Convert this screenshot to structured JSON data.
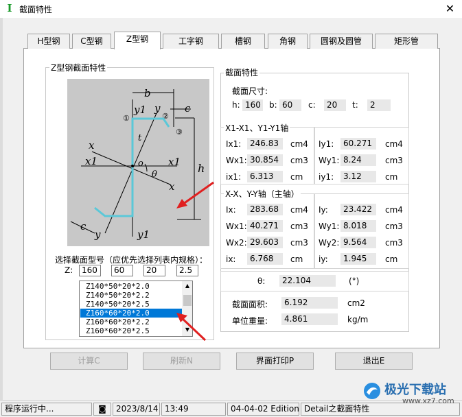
{
  "window": {
    "title": "截面特性"
  },
  "tabs": [
    "H型钢",
    "C型钢",
    "Z型钢",
    "工字钢",
    "槽钢",
    "角钢",
    "圆钢及圆管",
    "矩形管"
  ],
  "zsection": {
    "group_title": "Z型钢截面特性",
    "hint": "选择截面型号（应优先选择列表内规格）：",
    "z_label": "Z:",
    "inputs": [
      "160",
      "60",
      "20",
      "2.5"
    ],
    "list_items": [
      "Z140*50*20*2.0",
      "Z140*50*20*2.2",
      "Z140*50*20*2.5",
      "Z160*60*20*2.0",
      "Z160*60*20*2.2",
      "Z160*60*20*2.5"
    ],
    "selected_index": 3,
    "diagram_labels": {
      "b": "b",
      "y1": "y1",
      "y": "y",
      "c": "c",
      "n1": "①",
      "n2": "②",
      "n3": "③",
      "x": "x",
      "x1": "x1",
      "o": "o",
      "t": "t",
      "theta": "θ",
      "h": "h"
    }
  },
  "props": {
    "group_title": "截面特性",
    "dim_title": "截面尺寸:",
    "dims": [
      {
        "label": "h:",
        "value": "160"
      },
      {
        "label": "b:",
        "value": "60"
      },
      {
        "label": "c:",
        "value": "20"
      },
      {
        "label": "t:",
        "value": "2"
      }
    ],
    "axis1_title": "X1-X1、Y1-Y1轴",
    "axis1_rows": [
      {
        "l": "Ix1:",
        "v": "246.83",
        "u": "cm4",
        "l2": "Iy1:",
        "v2": "60.271",
        "u2": "cm4"
      },
      {
        "l": "Wx1:",
        "v": "30.854",
        "u": "cm3",
        "l2": "Wy1:",
        "v2": "8.24",
        "u2": "cm3"
      },
      {
        "l": "ix1:",
        "v": "6.313",
        "u": "cm",
        "l2": "iy1:",
        "v2": "3.12",
        "u2": "cm"
      }
    ],
    "axis2_title": "X-X、Y-Y轴（主轴）",
    "axis2_rows": [
      {
        "l": "Ix:",
        "v": "283.68",
        "u": "cm4",
        "l2": "Iy:",
        "v2": "23.422",
        "u2": "cm4"
      },
      {
        "l": "Wx1:",
        "v": "40.271",
        "u": "cm3",
        "l2": "Wy1:",
        "v2": "8.018",
        "u2": "cm3"
      },
      {
        "l": "Wx2:",
        "v": "29.603",
        "u": "cm3",
        "l2": "Wy2:",
        "v2": "9.564",
        "u2": "cm3"
      },
      {
        "l": "ix:",
        "v": "6.768",
        "u": "cm",
        "l2": "iy:",
        "v2": "1.945",
        "u2": "cm"
      }
    ],
    "theta": {
      "l": "θ:",
      "v": "22.104",
      "u": "(°)"
    },
    "area": {
      "l": "截面面积:",
      "v": "6.192",
      "u": "cm2"
    },
    "weight": {
      "l": "单位重量:",
      "v": "4.861",
      "u": "kg/m"
    }
  },
  "buttons": {
    "calc": "计算C",
    "refresh": "刷新N",
    "print": "界面打印P",
    "exit": "退出E"
  },
  "status": {
    "state": "程序运行中...",
    "date": "2023/8/14",
    "time": "13:49",
    "edition": "04-04-02 Edition",
    "module": "Detail之截面特性"
  },
  "watermark": {
    "text": "极光下载站",
    "url": "www.xz7.com"
  },
  "colors": {
    "accent": "#0078d7",
    "arrow": "#e02020",
    "steel": "#5bc8d8"
  }
}
